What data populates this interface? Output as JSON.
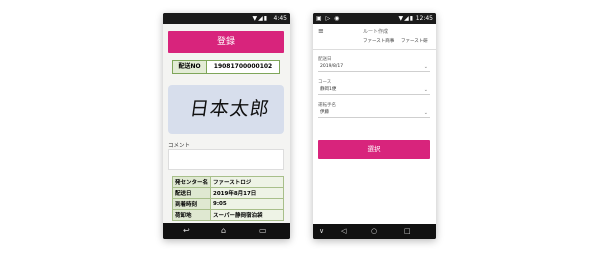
{
  "phone1": {
    "status_bar": {
      "time": "4:45",
      "icons": "▼◢▮",
      "left_icons": ""
    },
    "register_button": "登録",
    "delivery_no": {
      "label": "配送NO",
      "value": "19081700000102"
    },
    "signature_text": "日本太郎",
    "comment_label": "コメント",
    "comment_value": "",
    "info_table": [
      {
        "key": "発センター名",
        "value": "ファーストロジ"
      },
      {
        "key": "配送日",
        "value": "2019年8月17日"
      },
      {
        "key": "到着時刻",
        "value": "9:05"
      },
      {
        "key": "荷卸地",
        "value": "スーパー静岡宿泊袋"
      }
    ],
    "nav": {
      "back": "↩",
      "home": "⌂",
      "recent": "▭"
    }
  },
  "phone2": {
    "status_bar": {
      "time": "12:45",
      "icons": "▼◢▮",
      "left_icons": "▣ ▷ ◉"
    },
    "menu_icon": "≡",
    "title": "ルート作成",
    "tabs": [
      "ファースト商事",
      "ファースト研"
    ],
    "fields": [
      {
        "label": "配送日",
        "value": "2019/8/17"
      },
      {
        "label": "コース",
        "value": "静岡1便"
      },
      {
        "label": "運転手名",
        "value": "伊藤"
      }
    ],
    "select_button": "選択",
    "nav": {
      "left": "∨",
      "back": "◁",
      "home": "○",
      "recent": "□"
    }
  }
}
